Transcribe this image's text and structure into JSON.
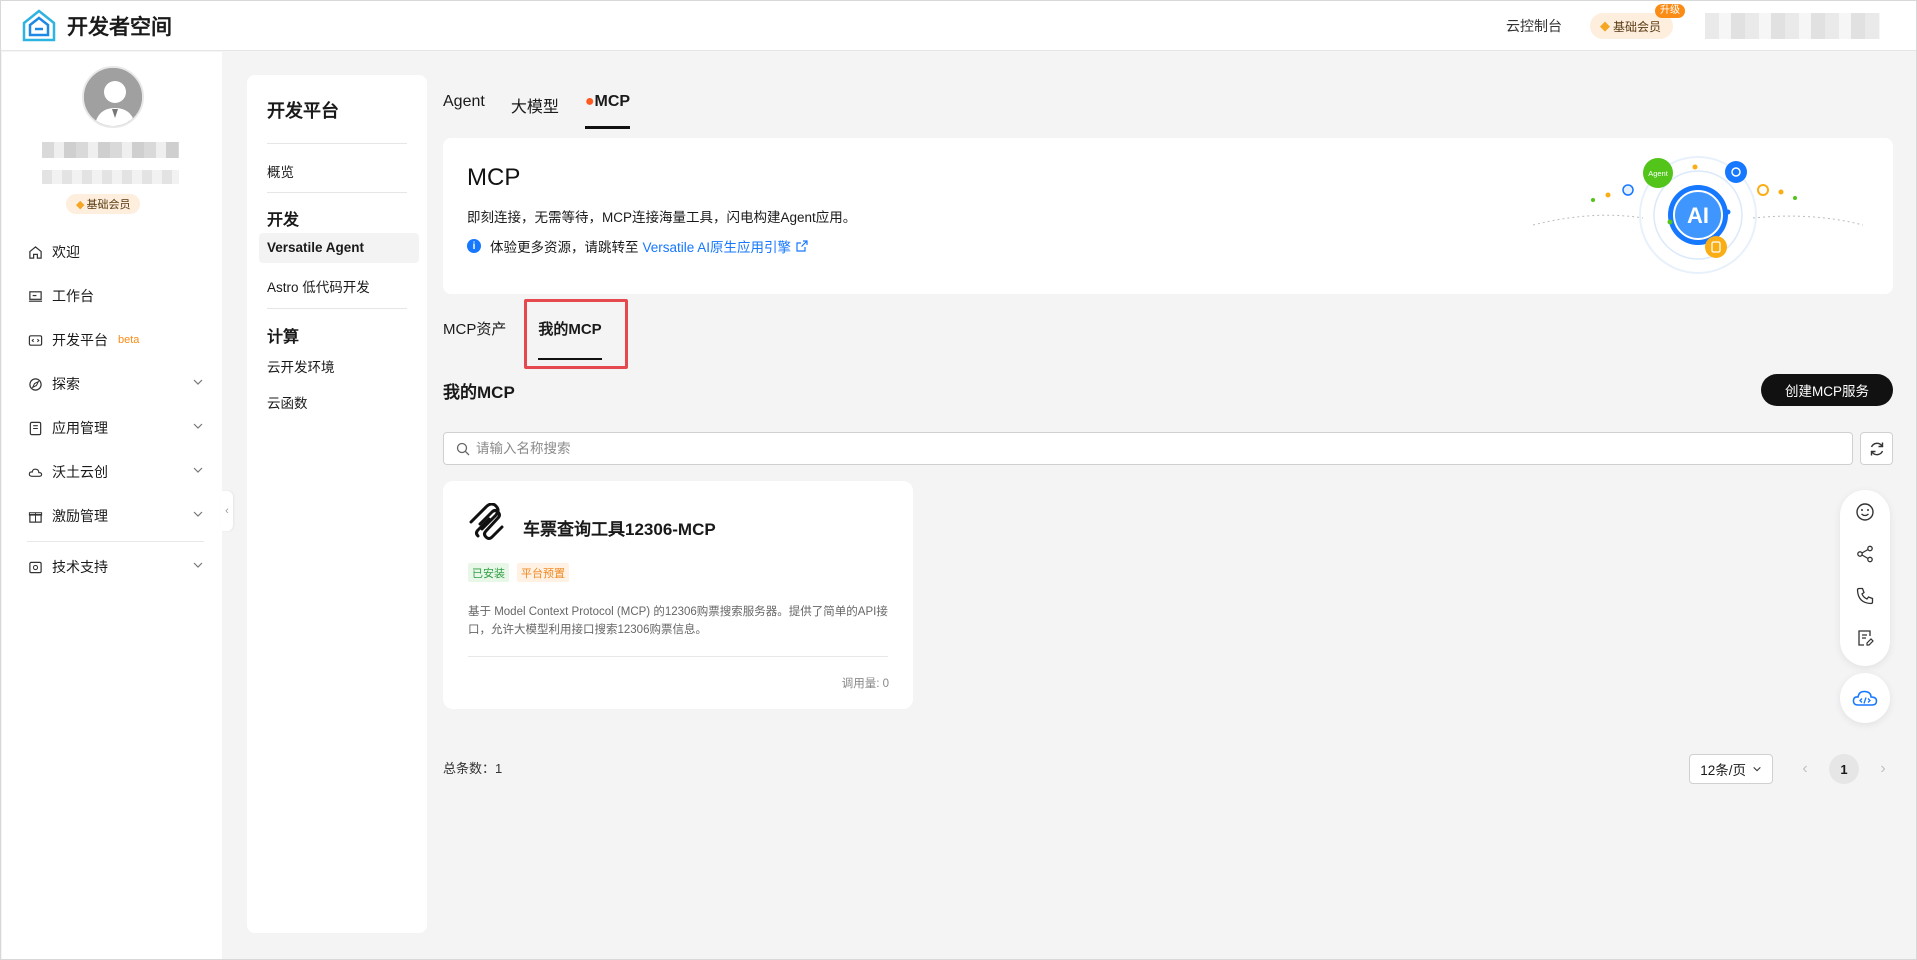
{
  "app": {
    "title": "开发者空间"
  },
  "header": {
    "console": "云控制台",
    "member_label": "基础会员",
    "upgrade": "升级"
  },
  "user": {
    "member_badge": "基础会员"
  },
  "sidebar": {
    "items": [
      {
        "label": "欢迎",
        "icon": "home-icon"
      },
      {
        "label": "工作台",
        "icon": "monitor-icon"
      },
      {
        "label": "开发平台",
        "icon": "code-icon",
        "badge": "beta"
      },
      {
        "label": "探索",
        "icon": "compass-icon"
      },
      {
        "label": "应用管理",
        "icon": "app-icon"
      },
      {
        "label": "沃土云创",
        "icon": "cloud-icon"
      },
      {
        "label": "激励管理",
        "icon": "gift-icon"
      },
      {
        "label": "技术支持",
        "icon": "support-icon"
      }
    ]
  },
  "submenu": {
    "title": "开发平台",
    "overview": "概览",
    "group_dev": "开发",
    "dev_items": [
      "Versatile Agent",
      "Astro 低代码开发"
    ],
    "group_compute": "计算",
    "compute_items": [
      "云开发环境",
      "云函数"
    ]
  },
  "tabs": [
    "Agent",
    "大模型",
    "MCP"
  ],
  "banner": {
    "title": "MCP",
    "desc": "即刻连接，无需等待，MCP连接海量工具，闪电构建Agent应用。",
    "info_prefix": "体验更多资源，请跳转至",
    "info_link": "Versatile AI原生应用引擎",
    "illustration_ai": "AI",
    "illustration_agent": "Agent"
  },
  "subtabs": [
    "MCP资产",
    "我的MCP"
  ],
  "section": {
    "title": "我的MCP",
    "create_button": "创建MCP服务"
  },
  "search": {
    "placeholder": "请输入名称搜索",
    "value": ""
  },
  "card": {
    "title": "车票查询工具12306-MCP",
    "tags": [
      "已安装",
      "平台预置"
    ],
    "desc": "基于 Model Context Protocol (MCP) 的12306购票搜索服务器。提供了简单的API接口，允许大模型利用接口搜索12306购票信息。",
    "calls": "调用量: 0"
  },
  "pagination": {
    "total_label": "总条数：1",
    "page_size": "12条/页",
    "current_page": "1"
  },
  "colors": {
    "accent": "#1677ff",
    "highlight_box": "#e5484d",
    "member_bg": "#fdeedd"
  }
}
